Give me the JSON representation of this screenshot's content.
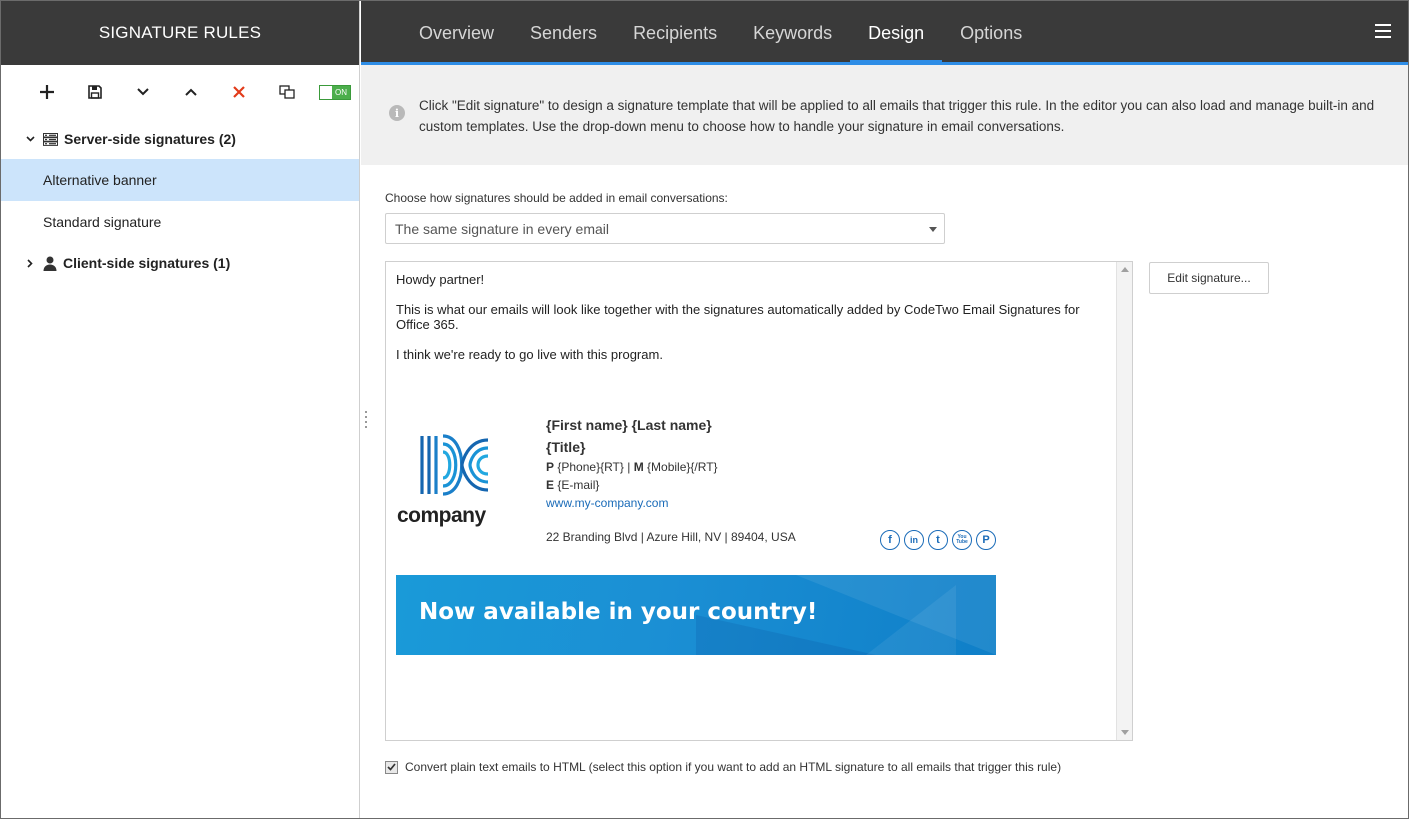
{
  "sidebar": {
    "title": "SIGNATURE RULES",
    "toggle_label": "ON",
    "groups": [
      {
        "label": "Server-side signatures (2)",
        "icon": "server-icon",
        "expanded": true,
        "items": [
          {
            "label": "Alternative banner"
          },
          {
            "label": "Standard signature"
          }
        ]
      },
      {
        "label": "Client-side signatures (1)",
        "icon": "user-icon",
        "expanded": false,
        "items": []
      }
    ]
  },
  "tabs": [
    {
      "label": "Overview"
    },
    {
      "label": "Senders"
    },
    {
      "label": "Recipients"
    },
    {
      "label": "Keywords"
    },
    {
      "label": "Design"
    },
    {
      "label": "Options"
    }
  ],
  "info_text": "Click \"Edit signature\" to design a signature template that will be applied to all emails that trigger this rule. In the editor you can also load and manage built-in and custom templates. Use the drop-down menu to choose how to handle your signature in email conversations.",
  "conversation": {
    "label": "Choose how signatures should be added in email conversations:",
    "selected": "The same signature in every email"
  },
  "preview": {
    "greeting": "Howdy partner!",
    "body": "This is what our emails will look like together with the signatures automatically added by CodeTwo Email Signatures for Office 365.",
    "closing": "I think we're ready to go live with this program.",
    "logo_text": "company",
    "name": "{First name} {Last name}",
    "title": "{Title}",
    "phone_label": "P",
    "phone_value": "{Phone}{RT}",
    "separator": "|",
    "mobile_label": "M",
    "mobile_value": "{Mobile}{/RT}",
    "email_label": "E",
    "email_value": "{E-mail}",
    "website": "www.my-company.com",
    "address": "22 Branding Blvd | Azure Hill, NV | 89404, USA",
    "socials": [
      {
        "icon": "facebook-icon",
        "glyph": "f"
      },
      {
        "icon": "linkedin-icon",
        "glyph": "in"
      },
      {
        "icon": "twitter-icon",
        "glyph": "t"
      },
      {
        "icon": "youtube-icon",
        "glyph": "You Tube"
      },
      {
        "icon": "pinterest-icon",
        "glyph": "P"
      }
    ],
    "banner_text": "Now available in your country!"
  },
  "edit_button": "Edit signature...",
  "convert_checkbox": {
    "checked": true,
    "label": "Convert plain text emails to HTML (select this option if you want to add an HTML signature to all emails that trigger this rule)"
  },
  "colors": {
    "header_bg": "#3a3a3a",
    "accent": "#2e8de6",
    "selected_row": "#cce4fb",
    "toggle_on": "#4cae4c",
    "delete_red": "#e23b1a",
    "link": "#1a6bb8"
  }
}
